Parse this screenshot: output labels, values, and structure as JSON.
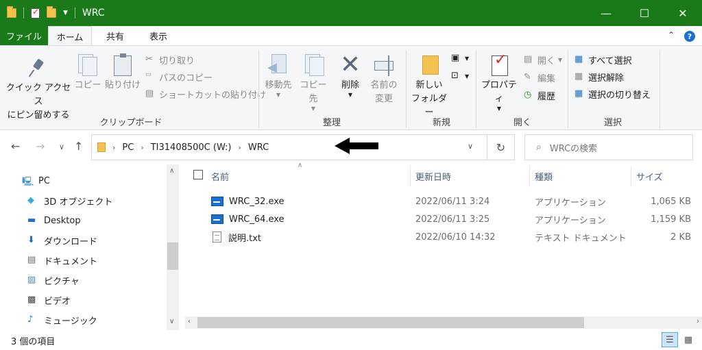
{
  "window": {
    "title": "WRC",
    "minimize": "—",
    "maximize": "☐",
    "close": "✕"
  },
  "tabs": {
    "file": "ファイル",
    "home": "ホーム",
    "share": "共有",
    "view": "表示"
  },
  "ribbon": {
    "clipboard": {
      "label": "クリップボード",
      "quick_access_line1": "クイック アクセス",
      "quick_access_line2": "にピン留めする",
      "copy": "コピー",
      "paste": "貼り付け",
      "cut": "切り取り",
      "copy_path": "パスのコピー",
      "paste_shortcut": "ショートカットの貼り付け"
    },
    "organize": {
      "label": "整理",
      "move_to": "移動先",
      "copy_to": "コピー先",
      "delete": "削除",
      "rename_line1": "名前の",
      "rename_line2": "変更"
    },
    "new": {
      "label": "新規",
      "new_folder_line1": "新しい",
      "new_folder_line2": "フォルダー"
    },
    "open": {
      "label": "開く",
      "properties": "プロパティ",
      "open": "開く",
      "edit": "編集",
      "history": "履歴"
    },
    "select": {
      "label": "選択",
      "select_all": "すべて選択",
      "select_none": "選択解除",
      "invert": "選択の切り替え"
    }
  },
  "address": {
    "segments": [
      "PC",
      "TI31408500C (W:)",
      "WRC"
    ],
    "search_placeholder": "WRCの検索"
  },
  "sidebar": {
    "items": [
      {
        "label": "PC",
        "icon": "pc-icon"
      },
      {
        "label": "3D オブジェクト",
        "icon": "3d-objects-icon"
      },
      {
        "label": "Desktop",
        "icon": "desktop-icon"
      },
      {
        "label": "ダウンロード",
        "icon": "download-icon"
      },
      {
        "label": "ドキュメント",
        "icon": "documents-icon"
      },
      {
        "label": "ピクチャ",
        "icon": "pictures-icon"
      },
      {
        "label": "ビデオ",
        "icon": "video-icon"
      },
      {
        "label": "ミュージック",
        "icon": "music-icon"
      }
    ]
  },
  "list": {
    "columns": {
      "name": "名前",
      "modified": "更新日時",
      "type": "種類",
      "size": "サイズ"
    },
    "rows": [
      {
        "name": "WRC_32.exe",
        "modified": "2022/06/11 3:24",
        "type": "アプリケーション",
        "size": "1,065 KB",
        "icon": "exe-icon"
      },
      {
        "name": "WRC_64.exe",
        "modified": "2022/06/11 3:25",
        "type": "アプリケーション",
        "size": "1,159 KB",
        "icon": "exe-icon"
      },
      {
        "name": "説明.txt",
        "modified": "2022/06/10 14:32",
        "type": "テキスト ドキュメント",
        "size": "2 KB",
        "icon": "text-file-icon"
      }
    ]
  },
  "status": {
    "item_count": "3 個の項目"
  },
  "colors": {
    "accent": "#1a7a1a",
    "ribbon_bg": "#f5f6f7"
  }
}
